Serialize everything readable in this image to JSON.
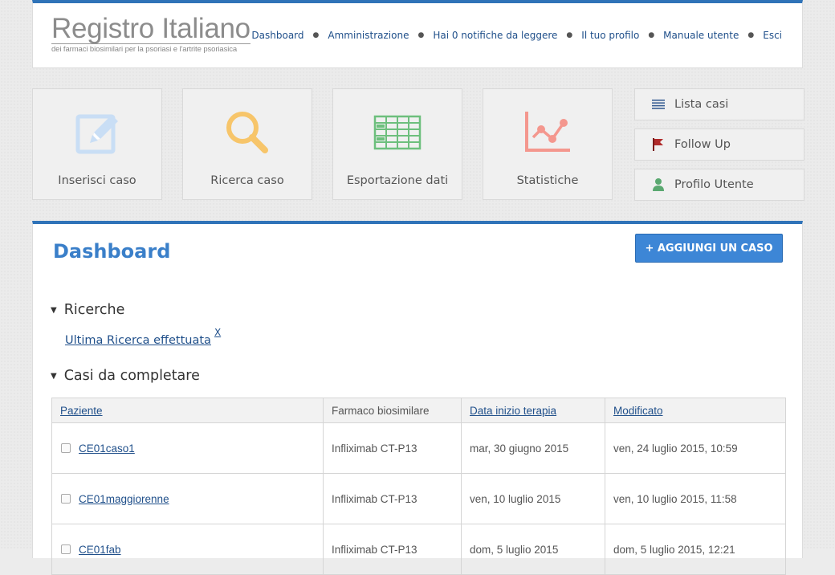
{
  "header": {
    "logo_title": "Registro Italiano",
    "logo_subtitle": "dei farmaci biosimilari per la psoriasi e l'artrite psoriasica",
    "nav": [
      {
        "label": "Dashboard"
      },
      {
        "label": "Amministrazione"
      },
      {
        "label": "Hai 0 notifiche da leggere"
      },
      {
        "label": "Il tuo profilo"
      },
      {
        "label": "Manuale utente"
      },
      {
        "label": "Esci"
      }
    ]
  },
  "tiles": [
    {
      "label": "Inserisci caso",
      "icon": "edit-icon"
    },
    {
      "label": "Ricerca caso",
      "icon": "search-icon"
    },
    {
      "label": "Esportazione dati",
      "icon": "table-icon"
    },
    {
      "label": "Statistiche",
      "icon": "chart-icon"
    }
  ],
  "side_buttons": [
    {
      "label": "Lista casi",
      "icon": "list-icon"
    },
    {
      "label": "Follow Up",
      "icon": "flag-icon"
    },
    {
      "label": "Profilo Utente",
      "icon": "user-icon"
    }
  ],
  "main": {
    "title": "Dashboard",
    "add_button": "+ AGGIUNGI UN CASO",
    "section_ricerche": "Ricerche",
    "last_search_link": "Ultima Ricerca effettuata",
    "last_search_close": "X",
    "section_casi": "Casi da completare",
    "table": {
      "headers": [
        "Paziente",
        "Farmaco biosimilare",
        "Data inizio terapia",
        "Modificato"
      ],
      "rows": [
        {
          "patient": "CE01caso1",
          "drug": "Infliximab CT-P13",
          "start": "mar, 30 giugno 2015",
          "modified": "ven, 24 luglio 2015, 10:59"
        },
        {
          "patient": "CE01maggiorenne",
          "drug": "Infliximab CT-P13",
          "start": "ven, 10 luglio 2015",
          "modified": "ven, 10 luglio 2015, 11:58"
        },
        {
          "patient": "CE01fab",
          "drug": "Infliximab CT-P13",
          "start": "dom, 5 luglio 2015",
          "modified": "dom, 5 luglio 2015, 12:21"
        }
      ]
    }
  },
  "colors": {
    "accent": "#2f73b8",
    "button": "#3d86d6",
    "link": "#1f4f8a",
    "title": "#3a7fc9"
  }
}
